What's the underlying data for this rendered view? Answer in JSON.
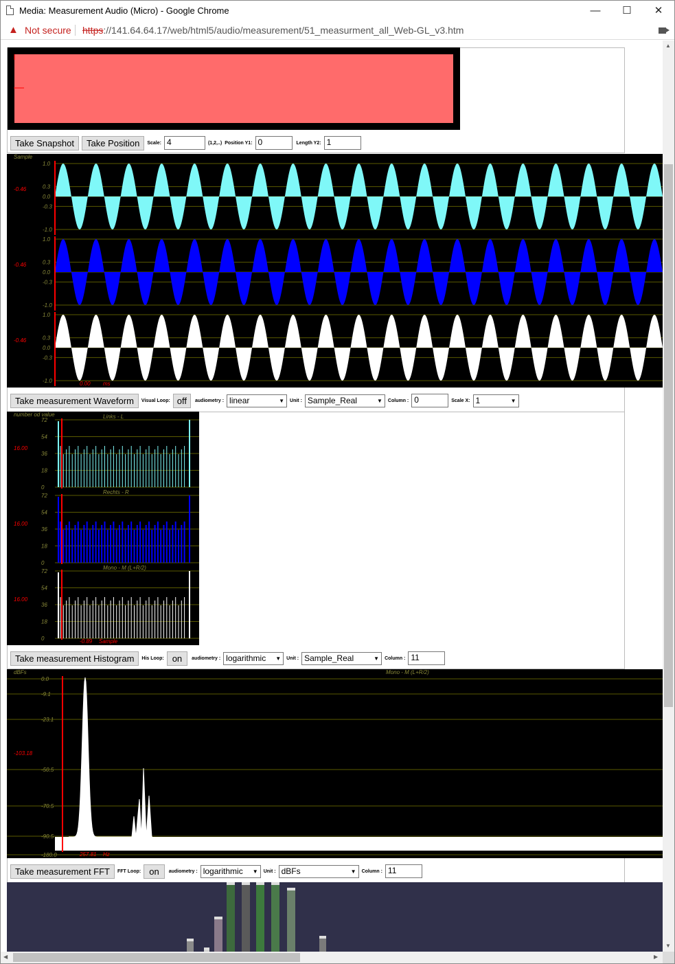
{
  "window": {
    "title": "Media: Measurement Audio (Micro) - Google Chrome",
    "minimize": "—",
    "maximize": "☐",
    "close": "✕"
  },
  "address_bar": {
    "security_label": "Not secure",
    "url_scheme": "https",
    "url_rest": "://141.64.64.17/web/html5/audio/measurement/51_measurment_all_Web-GL_v3.htm"
  },
  "colors": {
    "channel_left": "#7ff8f8",
    "channel_right": "#0000ff",
    "channel_mono": "#ffffff",
    "snapshot_fill": "#ff6b6b",
    "grid": "#5a5a00",
    "marker": "#ff0000",
    "gl_background": "#30304a"
  },
  "snapshot": {
    "take_snapshot": "Take Snapshot",
    "take_position": "Take Position",
    "scale_label": "Scale:",
    "scale_value": "4",
    "scale_hint": "(1,2,..)",
    "pos_y1_label": "Position Y1:",
    "pos_y1_value": "0",
    "len_y2_label": "Length Y2:",
    "len_y2_value": "1"
  },
  "waveform": {
    "y_title": "Sample",
    "y_ticks": [
      "1.0",
      "0.3",
      "0.0",
      "-0.3",
      "-1.0"
    ],
    "cursor_value": "-0.46",
    "x_readout": "0.00",
    "x_unit": "ms",
    "cycles_visible": 18.5,
    "button": "Take measurement Waveform",
    "loop_label": "Visual Loop:",
    "loop_value": "off",
    "audiometry_label": "audiometry :",
    "audiometry_value": "linear",
    "unit_label": "Unit :",
    "unit_value": "Sample_Real",
    "column_label": "Column :",
    "column_value": "0",
    "scalex_label": "Scale X:",
    "scalex_value": "1"
  },
  "histogram": {
    "y_title": "number od value",
    "channels": [
      "Links - L",
      "Rechts - R",
      "Mono - M (L+R/2)"
    ],
    "y_ticks": [
      "72",
      "54",
      "36",
      "18",
      "0"
    ],
    "cursor_value": "16.00",
    "x_readout": "-0.89",
    "x_unit": "Sample",
    "button": "Take measurement Histogram",
    "loop_label": "His Loop:",
    "loop_value": "on",
    "audiometry_label": "audiometry :",
    "audiometry_value": "logarithmic",
    "unit_label": "Unit :",
    "unit_value": "Sample_Real",
    "column_label": "Column :",
    "column_value": "11"
  },
  "fft": {
    "y_title": "dBFs",
    "channel": "Mono - M (L+R/2)",
    "y_ticks": [
      "0.0",
      "-9.1",
      "-23.1",
      "-50.5",
      "-70.5",
      "-90.5",
      "-180.0"
    ],
    "cursor_value": "-103.18",
    "x_readout": "257.81",
    "x_unit": "Hz",
    "button": "Take measurement FFT",
    "loop_label": "FFT Loop:",
    "loop_value": "on",
    "audiometry_label": "audiometry :",
    "audiometry_value": "logarithmic",
    "unit_label": "Unit :",
    "unit_value": "dBFs",
    "column_label": "Column :",
    "column_value": "11"
  },
  "scroll": {
    "up": "▲",
    "down": "▼",
    "left": "◀",
    "right": "▶"
  }
}
